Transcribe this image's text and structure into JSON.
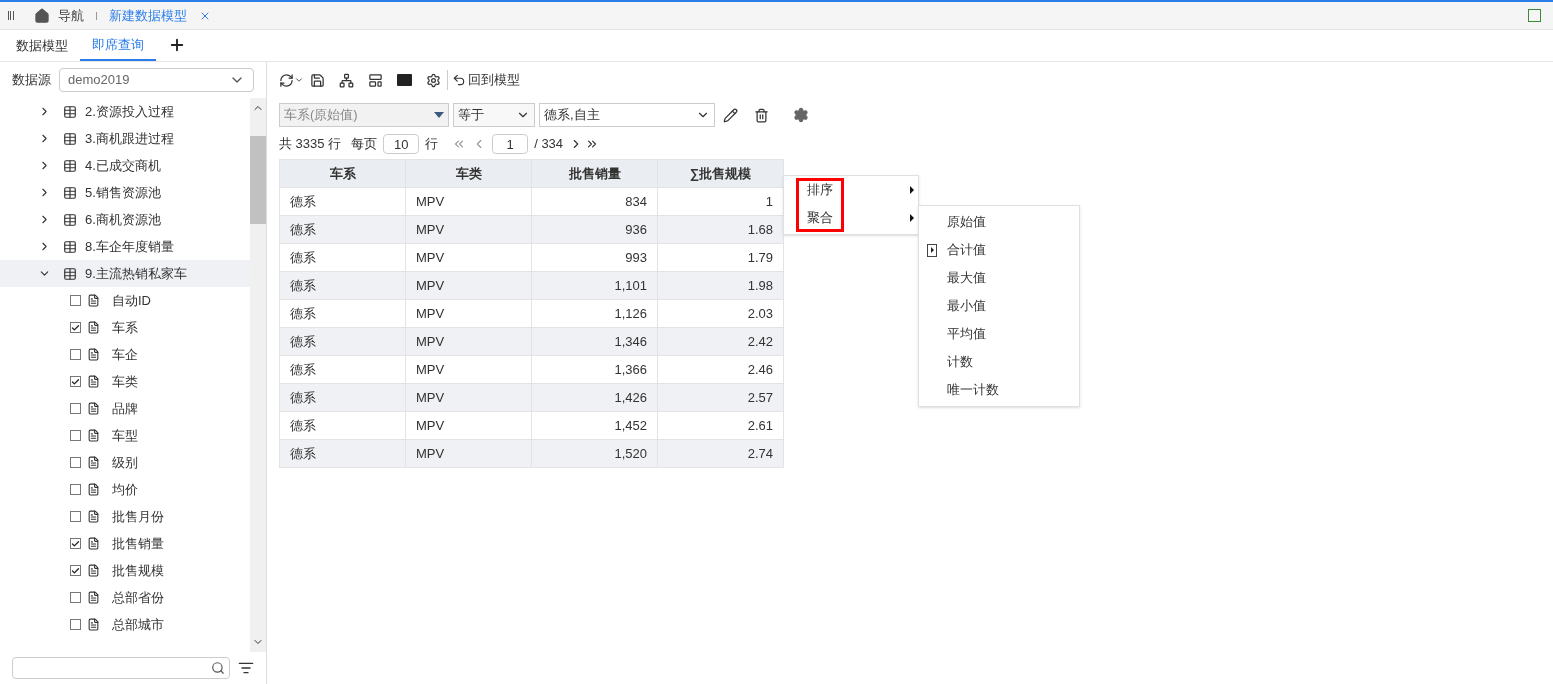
{
  "top_bar": {
    "home_label": "导航",
    "tabs": [
      {
        "label": "新建数据模型",
        "selected": true
      }
    ]
  },
  "sub_tabs": [
    {
      "label": "数据模型",
      "selected": false
    },
    {
      "label": "即席查询",
      "selected": true
    }
  ],
  "datasource": {
    "label": "数据源",
    "value": "demo2019"
  },
  "tree": [
    {
      "label": "2.资源投入过程",
      "expanded": false,
      "selected": false
    },
    {
      "label": "3.商机跟进过程",
      "expanded": false,
      "selected": false
    },
    {
      "label": "4.已成交商机",
      "expanded": false,
      "selected": false
    },
    {
      "label": "5.销售资源池",
      "expanded": false,
      "selected": false
    },
    {
      "label": "6.商机资源池",
      "expanded": false,
      "selected": false
    },
    {
      "label": "8.车企年度销量",
      "expanded": false,
      "selected": false
    },
    {
      "label": "9.主流热销私家车",
      "expanded": true,
      "selected": true,
      "children": [
        {
          "label": "自动ID",
          "checked": false
        },
        {
          "label": "车系",
          "checked": true
        },
        {
          "label": "车企",
          "checked": false
        },
        {
          "label": "车类",
          "checked": true
        },
        {
          "label": "品牌",
          "checked": false
        },
        {
          "label": "车型",
          "checked": false
        },
        {
          "label": "级别",
          "checked": false
        },
        {
          "label": "均价",
          "checked": false
        },
        {
          "label": "批售月份",
          "checked": false
        },
        {
          "label": "批售销量",
          "checked": true
        },
        {
          "label": "批售规模",
          "checked": true
        },
        {
          "label": "总部省份",
          "checked": false
        },
        {
          "label": "总部城市",
          "checked": false
        }
      ]
    }
  ],
  "toolbar": {
    "back_label": "回到模型"
  },
  "filter": {
    "field": "车系(原始值)",
    "operator": "等于",
    "value": "德系,自主"
  },
  "pager": {
    "total": "共 3335 行",
    "per_page_label": "每页",
    "per_page": "10",
    "row_unit": "行",
    "page": "1",
    "page_count": "/ 334"
  },
  "table": {
    "columns": [
      "车系",
      "车类",
      "批售销量",
      "∑批售规模"
    ],
    "rows": [
      [
        "德系",
        "MPV",
        "834",
        "1"
      ],
      [
        "德系",
        "MPV",
        "936",
        "1.68"
      ],
      [
        "德系",
        "MPV",
        "993",
        "1.79"
      ],
      [
        "德系",
        "MPV",
        "1,101",
        "1.98"
      ],
      [
        "德系",
        "MPV",
        "1,126",
        "2.03"
      ],
      [
        "德系",
        "MPV",
        "1,346",
        "2.42"
      ],
      [
        "德系",
        "MPV",
        "1,366",
        "2.46"
      ],
      [
        "德系",
        "MPV",
        "1,426",
        "2.57"
      ],
      [
        "德系",
        "MPV",
        "1,452",
        "2.61"
      ],
      [
        "德系",
        "MPV",
        "1,520",
        "2.74"
      ]
    ]
  },
  "context_menu": {
    "items": [
      "排序",
      "聚合"
    ],
    "submenu": [
      {
        "label": "原始值",
        "selected": false
      },
      {
        "label": "合计值",
        "selected": true
      },
      {
        "label": "最大值",
        "selected": false
      },
      {
        "label": "最小值",
        "selected": false
      },
      {
        "label": "平均值",
        "selected": false
      },
      {
        "label": "计数",
        "selected": false
      },
      {
        "label": "唯一计数",
        "selected": false
      }
    ]
  }
}
